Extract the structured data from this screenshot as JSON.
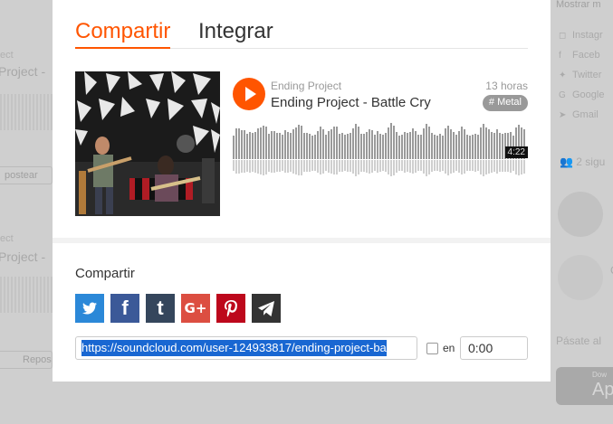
{
  "background_left": {
    "ghost_titles": [
      "Project -",
      "Project -"
    ],
    "repost_buttons": [
      "postear",
      "Repos"
    ]
  },
  "background_right": {
    "share_title": "Mostrar m",
    "share_items": [
      {
        "icon": "instagram-icon",
        "label": "Instagr"
      },
      {
        "icon": "facebook-icon",
        "label": "Faceb"
      },
      {
        "icon": "twitter-icon",
        "label": "Twitter"
      },
      {
        "icon": "google-plus-icon",
        "label": "Google"
      },
      {
        "icon": "email-icon",
        "label": "Gmail"
      }
    ],
    "followers_text": "2 sigu",
    "avatar_letter": "C",
    "promo_text": "Pásate al",
    "appstore": {
      "small": "Dow",
      "name": "App"
    }
  },
  "modal": {
    "tabs": [
      {
        "label": "Compartir",
        "active": true
      },
      {
        "label": "Integrar",
        "active": false
      }
    ],
    "track": {
      "artist": "Ending Project",
      "title": "Ending Project - Battle Cry",
      "posted_ago": "13 horas",
      "genre_tag": "# Metal",
      "duration": "4:22"
    },
    "share": {
      "label": "Compartir",
      "networks": [
        {
          "name": "twitter",
          "icon": "twitter-icon"
        },
        {
          "name": "facebook",
          "icon": "facebook-icon",
          "glyph": "f"
        },
        {
          "name": "tumblr",
          "icon": "tumblr-icon",
          "glyph": "t"
        },
        {
          "name": "google-plus",
          "icon": "google-plus-icon",
          "glyph": "G+"
        },
        {
          "name": "pinterest",
          "icon": "pinterest-icon"
        },
        {
          "name": "email",
          "icon": "send-icon"
        }
      ],
      "url_value": "https://soundcloud.com/user-124933817/ending-project-ba",
      "start_at_label": "en",
      "start_at_value": "0:00"
    }
  },
  "colors": {
    "accent": "#ff5500",
    "twitter": "#2b88d8",
    "facebook": "#3b5998",
    "tumblr": "#35465c",
    "google_plus": "#dc4e41",
    "pinterest": "#bd081c",
    "email": "#333333",
    "selection": "#1967d2"
  }
}
